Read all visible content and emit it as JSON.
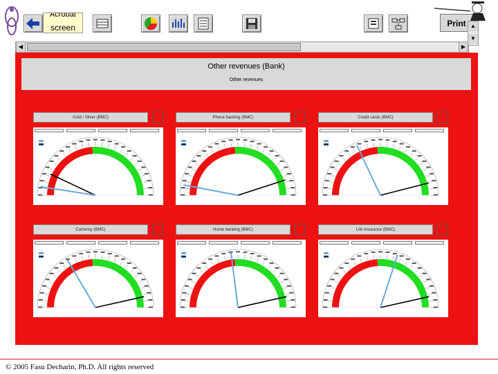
{
  "toolbar": {
    "screen_button_label": "screen",
    "screen_button_top_label": "Acrobat",
    "print_button_label": "Print"
  },
  "dashboard": {
    "title": "Other revenues (Bank)",
    "subtitle": "Other revenues",
    "gauges": [
      {
        "title": "Gold / Silver (BMC)",
        "needle_value": 0.05,
        "target_value": 0.14
      },
      {
        "title": "Phone banking (BMC)",
        "needle_value": 0.06,
        "target_value": 0.9
      },
      {
        "title": "Credit cards (BMC)",
        "needle_value": 0.36,
        "target_value": 0.92
      },
      {
        "title": "Currency (BMC)",
        "needle_value": 0.33,
        "target_value": 0.93
      },
      {
        "title": "Home banking (BMC)",
        "needle_value": 0.46,
        "target_value": 0.93
      },
      {
        "title": "Life insurance (BMC)",
        "needle_value": 0.6,
        "target_value": 0.93
      }
    ],
    "gauge_colors": {
      "red": "#ee1111",
      "green": "#22dd22",
      "needle": "#6aa8d8",
      "target": "#000000"
    }
  },
  "footer": {
    "copyright": "© 2005 Fasu Decharin, Ph.D. All rights reserved"
  },
  "icons": [
    "back-arrow-icon",
    "table-icon",
    "pie-chart-icon",
    "bar-chart-icon",
    "document-icon",
    "save-icon",
    "report-icon",
    "org-chart-icon",
    "presenter-icon"
  ]
}
